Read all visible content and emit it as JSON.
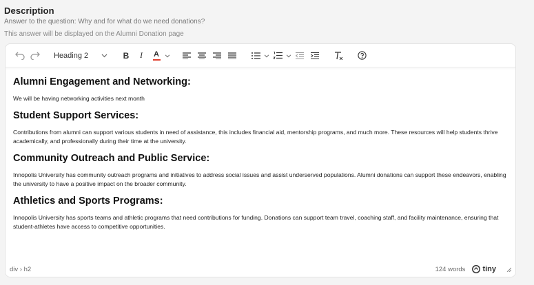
{
  "field": {
    "title": "Description",
    "subtitle": "Answer to the question: Why and for what do we need donations?",
    "hint": "This answer will be displayed on the Alumni Donation page"
  },
  "toolbar": {
    "block_format": "Heading 2",
    "icons": [
      "undo-icon",
      "redo-icon",
      "bold-icon",
      "italic-icon",
      "text-color-icon",
      "align-left-icon",
      "align-center-icon",
      "align-right-icon",
      "align-justify-icon",
      "bullet-list-icon",
      "numbered-list-icon",
      "outdent-icon",
      "indent-icon",
      "clear-formatting-icon",
      "help-icon"
    ],
    "bold_glyph": "B",
    "italic_glyph": "I",
    "text_color_glyph": "A",
    "text_color": "#e03e2d"
  },
  "content": {
    "sections": [
      {
        "heading": "Alumni Engagement and Networking:",
        "paragraph": "We will be having networking activities next month"
      },
      {
        "heading": "Student Support Services:",
        "paragraph": "Contributions from alumni can support various students in need of assistance, this includes financial aid, mentorship programs, and much more. These resources will help students thrive academically, and professionally during their time at the university."
      },
      {
        "heading": "Community Outreach and Public Service:",
        "paragraph": "Innopolis University has community outreach programs and initiatives to address social issues and assist underserved populations. Alumni donations can support these endeavors, enabling the university to have a positive impact on the broader community."
      },
      {
        "heading": "Athletics and Sports Programs:",
        "paragraph": "Innopolis University has sports teams and athletic programs that need contributions for funding. Donations can support team travel, coaching staff, and facility maintenance, ensuring that student-athletes have access to competitive opportunities."
      }
    ]
  },
  "statusbar": {
    "path": "div › h2",
    "word_count": "124 words",
    "brand": "tiny"
  }
}
